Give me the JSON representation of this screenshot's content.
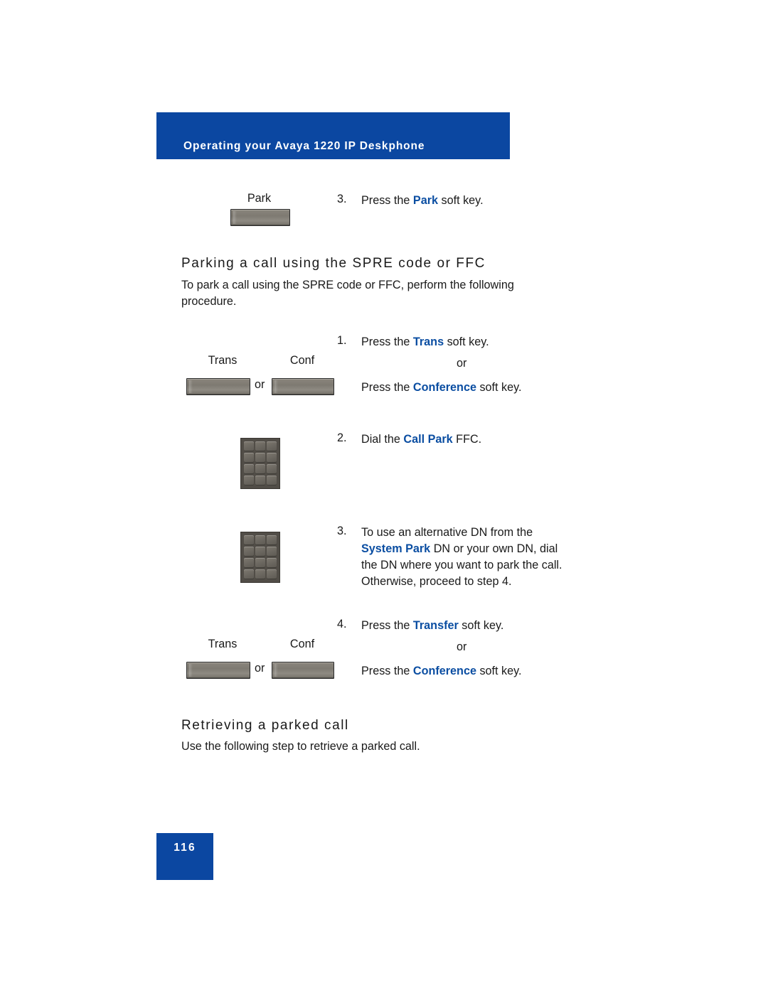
{
  "header": {
    "title": "Operating your Avaya 1220 IP Deskphone"
  },
  "park_step": {
    "key_label": "Park",
    "number": "3.",
    "text_before": "Press the ",
    "keyword": "Park",
    "text_after": " soft key."
  },
  "section_spre": {
    "heading": "Parking a call using the SPRE code or FFC",
    "intro_line1": "To park a call using the SPRE code or FFC, perform the following",
    "intro_line2": "procedure."
  },
  "step1": {
    "number": "1.",
    "line1_before": "Press the ",
    "line1_keyword": "Trans",
    "line1_after": " soft key.",
    "or": "or",
    "line2_before": "Press the ",
    "line2_keyword": "Conference",
    "line2_after": " soft key.",
    "trans_label": "Trans",
    "conf_label": "Conf",
    "between_or": "or"
  },
  "step2": {
    "number": "2.",
    "text_before": "Dial the ",
    "keyword": "Call Park",
    "text_after": " FFC."
  },
  "step3": {
    "number": "3.",
    "line1": "To use an alternative DN from the",
    "line2_keyword": "System Park",
    "line2_after": " DN or your own DN, dial",
    "line3": "the DN where you want to park the call.",
    "line4": "Otherwise, proceed to step 4."
  },
  "step4": {
    "number": "4.",
    "line1_before": "Press the ",
    "line1_keyword": "Transfer",
    "line1_after": " soft key.",
    "or": "or",
    "line2_before": "Press the ",
    "line2_keyword": "Conference",
    "line2_after": " soft key.",
    "trans_label": "Trans",
    "conf_label": "Conf",
    "between_or": "or"
  },
  "section_retrieve": {
    "heading": "Retrieving a parked call",
    "intro": "Use the following step to retrieve a parked call."
  },
  "footer": {
    "page_number": "116"
  },
  "colors": {
    "brand_blue": "#0B47A1",
    "keyword_blue": "#0B4EA2",
    "text": "#1a1a1a",
    "softkey_gray": "#837f77"
  }
}
